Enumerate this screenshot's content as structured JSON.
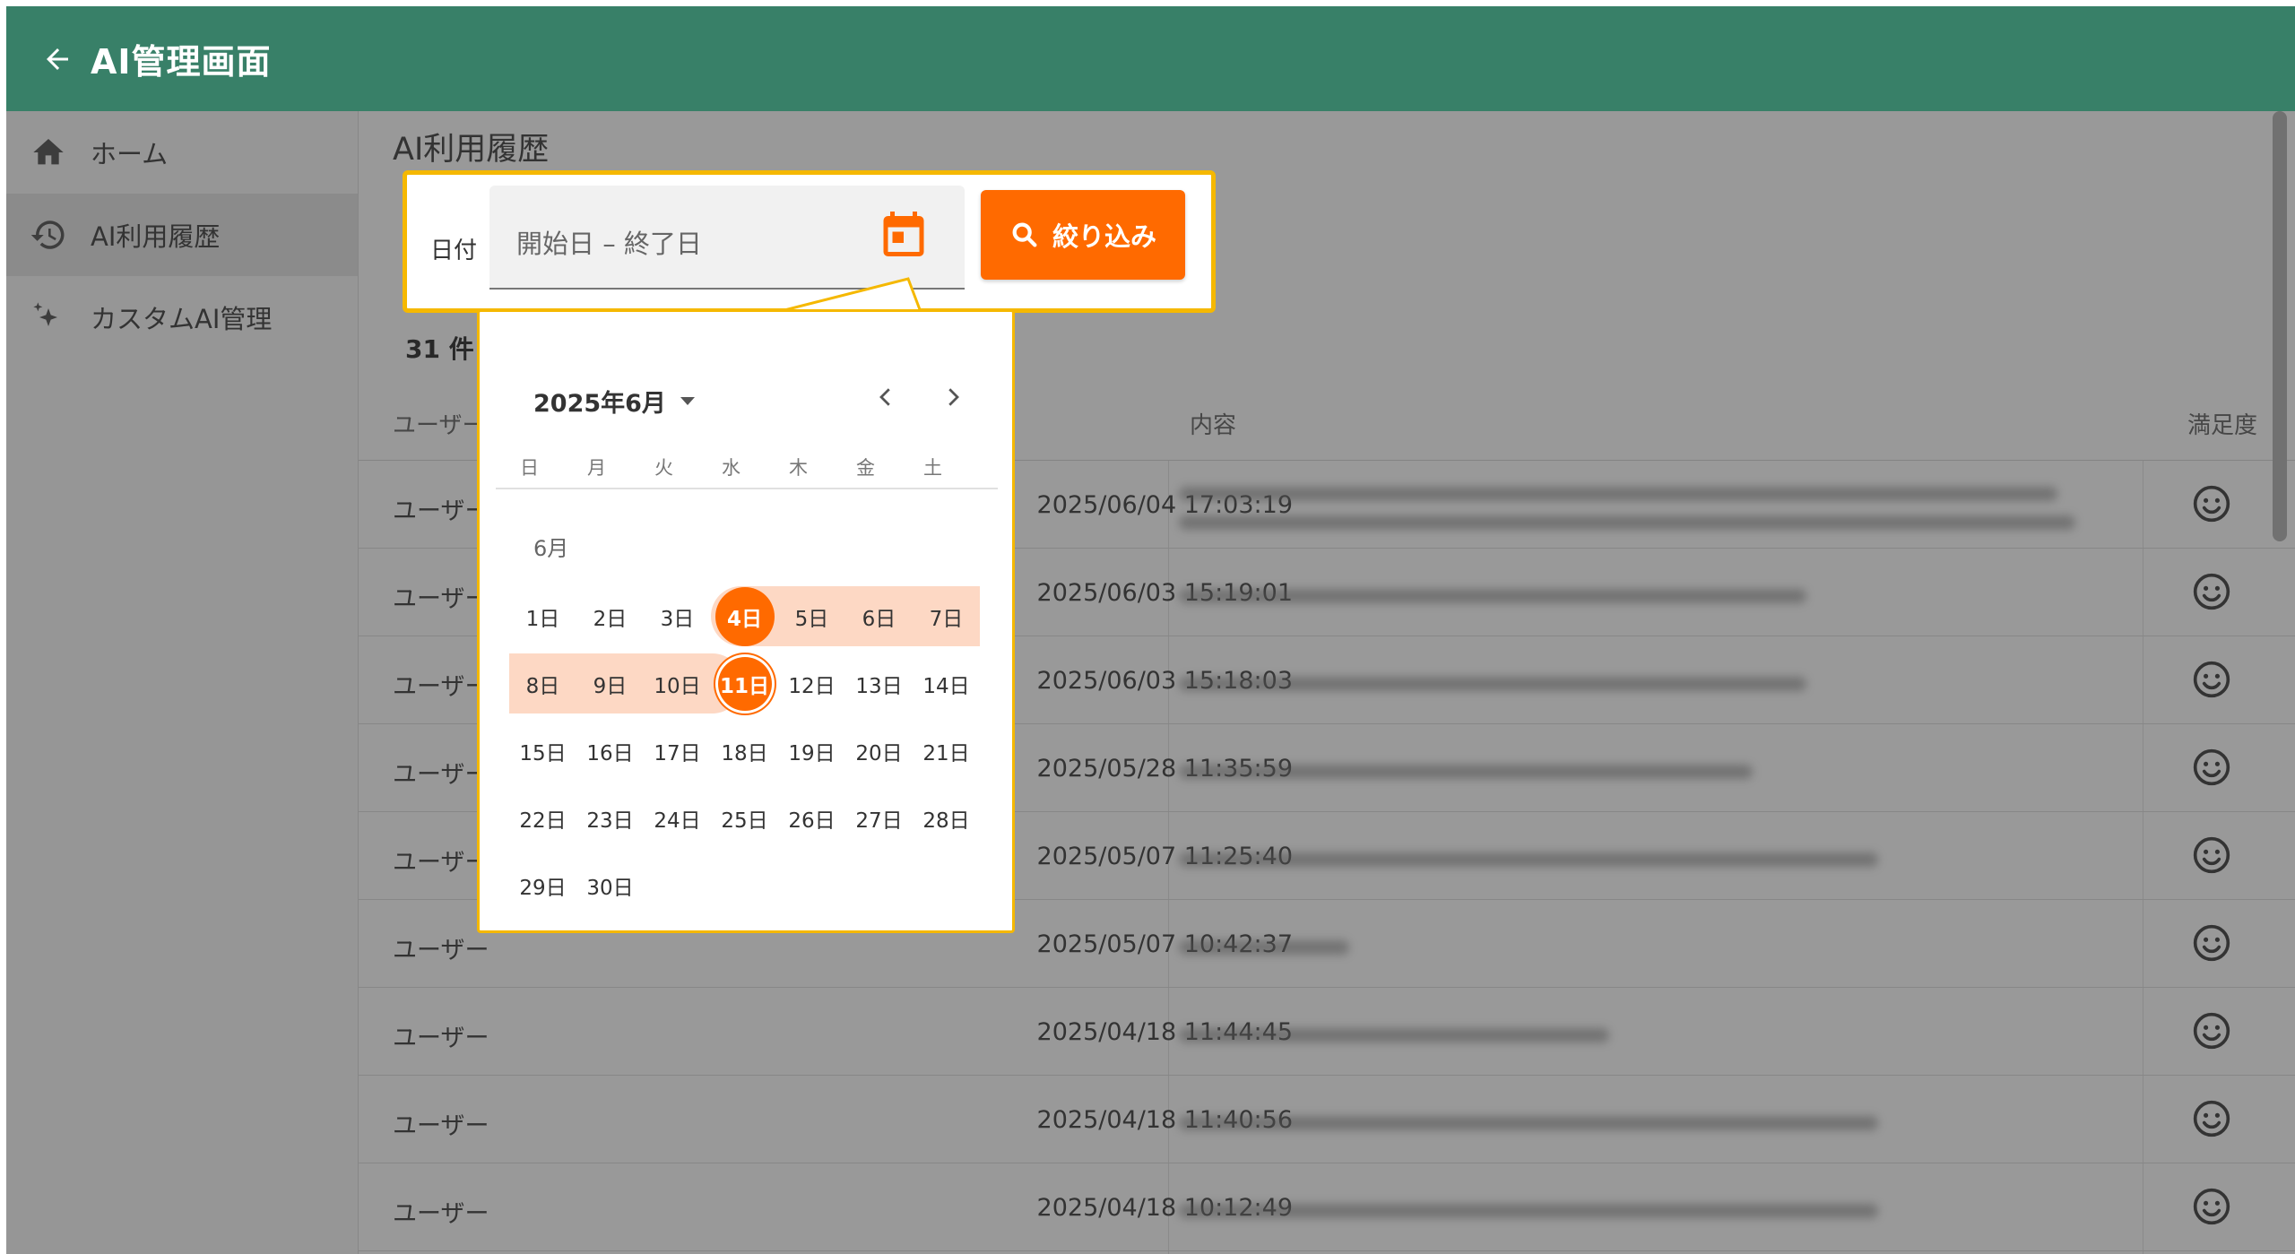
{
  "header": {
    "title": "AI管理画面"
  },
  "sidebar": {
    "items": [
      {
        "label": "ホーム",
        "icon": "home-icon"
      },
      {
        "label": "AI利用履歴",
        "icon": "history-icon",
        "active": true
      },
      {
        "label": "カスタムAI管理",
        "icon": "sparkle-icon"
      }
    ]
  },
  "main": {
    "page_title": "AI利用履歴",
    "count": "31 件",
    "columns": {
      "user": "ユーザー",
      "content": "内容",
      "satisfaction": "満足度"
    },
    "rows": [
      {
        "user": "ユーザー",
        "date": "2025/06/04 17:03:19"
      },
      {
        "user": "ユーザー",
        "date": "2025/06/03 15:19:01"
      },
      {
        "user": "ユーザー",
        "date": "2025/06/03 15:18:03"
      },
      {
        "user": "ユーザー",
        "date": "2025/05/28 11:35:59"
      },
      {
        "user": "ユーザー",
        "date": "2025/05/07 11:25:40"
      },
      {
        "user": "ユーザー",
        "date": "2025/05/07 10:42:37"
      },
      {
        "user": "ユーザー",
        "date": "2025/04/18 11:44:45"
      },
      {
        "user": "ユーザー",
        "date": "2025/04/18 11:40:56"
      },
      {
        "user": "ユーザー",
        "date": "2025/04/18 10:12:49"
      }
    ]
  },
  "filter": {
    "label": "日付",
    "date_placeholder": "開始日 – 終了日",
    "button_label": "絞り込み"
  },
  "calendar": {
    "header": "2025年6月",
    "weekdays": [
      "日",
      "月",
      "火",
      "水",
      "木",
      "金",
      "土"
    ],
    "month_label": "6月",
    "weeks": [
      [
        "1日",
        "2日",
        "3日",
        "4日",
        "5日",
        "6日",
        "7日"
      ],
      [
        "8日",
        "9日",
        "10日",
        "11日",
        "12日",
        "13日",
        "14日"
      ],
      [
        "15日",
        "16日",
        "17日",
        "18日",
        "19日",
        "20日",
        "21日"
      ],
      [
        "22日",
        "23日",
        "24日",
        "25日",
        "26日",
        "27日",
        "28日"
      ],
      [
        "29日",
        "30日"
      ]
    ],
    "range_start": "4日",
    "range_end": "11日"
  },
  "colors": {
    "appbar": "#388068",
    "accent": "#ff6a00",
    "highlight_border": "#f5b800",
    "range_fill": "#fdd8c4"
  }
}
